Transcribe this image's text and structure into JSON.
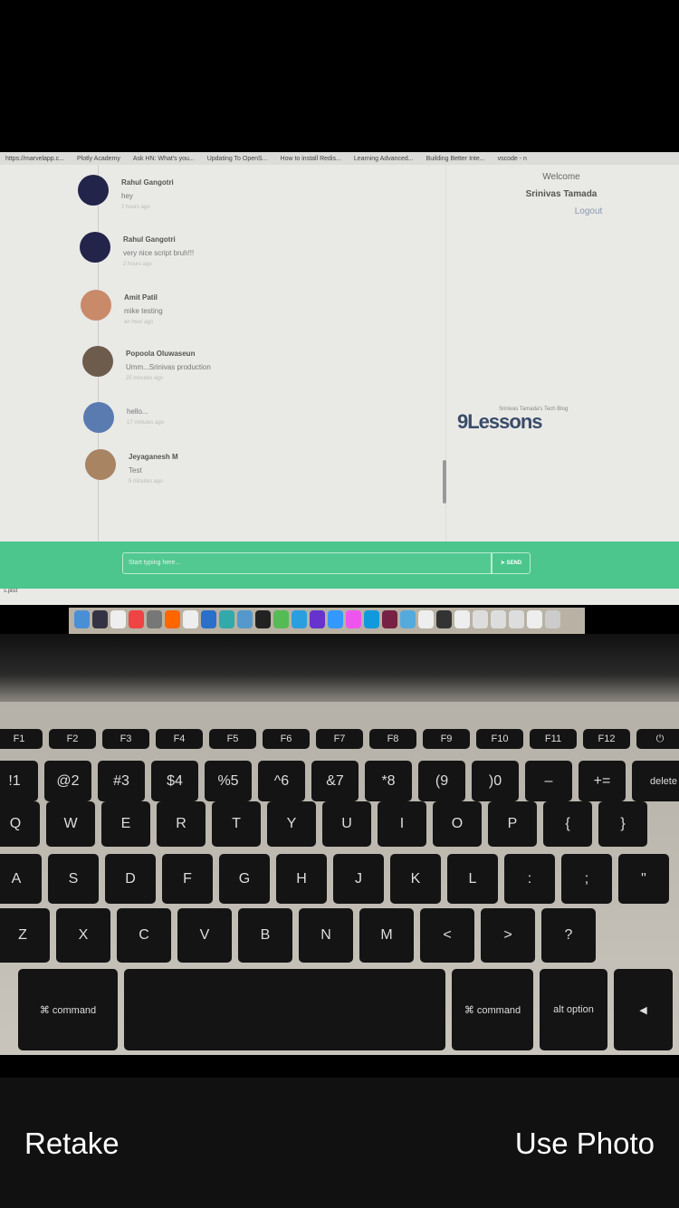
{
  "browser": {
    "bookmarks": [
      "https://marvelapp.c...",
      "Plotly Academy",
      "Ask HN: What's you...",
      "Updating To OpenS...",
      "How to install Redis...",
      "Learning Advanced...",
      "Building Better Inte...",
      "vscode - n"
    ]
  },
  "chat": {
    "messages": [
      {
        "name": "Rahul Gangotri",
        "text": "hey",
        "time": "2 hours ago",
        "avatar_color": "#22244a"
      },
      {
        "name": "Rahul Gangotri",
        "text": "very nice script bruh!!!",
        "time": "2 hours ago",
        "avatar_color": "#22244a"
      },
      {
        "name": "Amit Patil",
        "text": "mike testing",
        "time": "an hour ago",
        "avatar_color": "#c98a6a"
      },
      {
        "name": "Popoola Oluwaseun",
        "text": "Umm...Srinivas production",
        "time": "25 minutes ago",
        "avatar_color": "#6d5b4c"
      },
      {
        "name": "",
        "text": "hello...",
        "time": "17 minutes ago",
        "avatar_color": "#5a7bb0"
      },
      {
        "name": "Jeyaganesh M",
        "text": "Test",
        "time": "5 minutes ago",
        "avatar_color": "#a88462"
      }
    ],
    "input_placeholder": "Start typing here...",
    "send_label": "SEND",
    "accent": "#4cc68c"
  },
  "sidebar": {
    "welcome": "Welcome",
    "user": "Srinivas Tamada",
    "logout": "Logout",
    "logo": "9Lessons",
    "logo_tagline": "Srinivas Tamada's Tech Blog"
  },
  "terminal_tab": "s.plist",
  "keyboard": {
    "rows": [
      [
        "F1",
        "F2",
        "F3",
        "F4",
        "F5",
        "F6",
        "F7",
        "F8",
        "F9",
        "F10",
        "F11",
        "F12",
        "⏻"
      ],
      [
        "!1",
        "@2",
        "#3",
        "$4",
        "%5",
        "^6",
        "&7",
        "*8",
        "(9",
        ")0",
        "–",
        "+=",
        "delete"
      ],
      [
        "Q",
        "W",
        "E",
        "R",
        "T",
        "Y",
        "U",
        "I",
        "O",
        "P",
        "{",
        "}"
      ],
      [
        "A",
        "S",
        "D",
        "F",
        "G",
        "H",
        "J",
        "K",
        "L",
        ":",
        ";",
        "\""
      ],
      [
        "Z",
        "X",
        "C",
        "V",
        "B",
        "N",
        "M",
        "<",
        ">",
        "?"
      ],
      [
        "⌘ command",
        "",
        "⌘ command",
        "alt option",
        "◀"
      ]
    ]
  },
  "camera": {
    "retake": "Retake",
    "use_photo": "Use Photo"
  }
}
